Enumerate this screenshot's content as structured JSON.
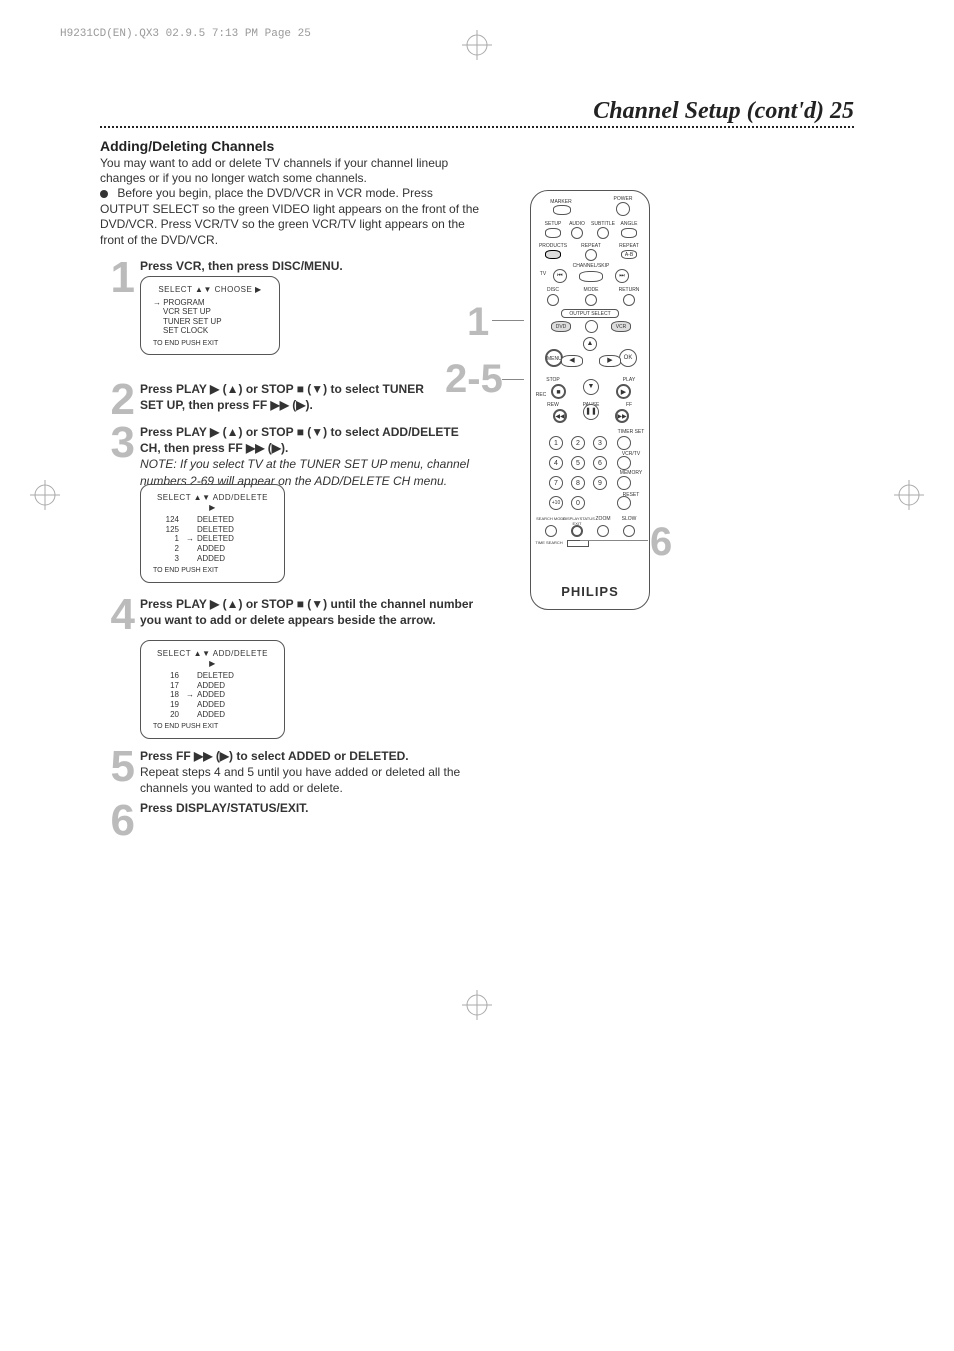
{
  "header_tag": "H9231CD(EN).QX3  02.9.5 7:13 PM  Page 25",
  "page_title": "Channel Setup (cont'd) 25",
  "section_heading": "Adding/Deleting Channels",
  "intro": "You may want to add or delete TV channels if your channel lineup changes or if you no longer watch some channels.",
  "bullet": "Before you begin, place the DVD/VCR in VCR mode. Press OUTPUT SELECT so the green VIDEO light appears on the front of the DVD/VCR. Press VCR/TV so the green VCR/TV light appears on the front of the DVD/VCR.",
  "steps": {
    "1": {
      "num": "1",
      "text_bold": "Press VCR, then press DISC/MENU.",
      "osd": {
        "head": "SELECT ▲▼ CHOOSE ▶",
        "lines": [
          "→ PROGRAM",
          "    VCR SET UP",
          "    TUNER SET UP",
          "    SET CLOCK"
        ],
        "foot": "TO END PUSH EXIT"
      }
    },
    "2": {
      "num": "2",
      "text": "Press PLAY ▶ (▲) or STOP ■ (▼) to select TUNER SET UP, then press FF ▶▶ (▶)."
    },
    "3": {
      "num": "3",
      "text": "Press PLAY ▶ (▲) or STOP ■ (▼) to select ADD/DELETE CH, then press FF ▶▶ (▶).",
      "note": "NOTE: If you select TV at the TUNER SET UP menu, channel numbers 2-69 will appear on the ADD/DELETE CH menu.",
      "osd": {
        "head": "SELECT ▲▼ ADD/DELETE ▶",
        "rows": [
          {
            "ch": "124",
            "arrow": "",
            "status": "DELETED"
          },
          {
            "ch": "125",
            "arrow": "",
            "status": "DELETED"
          },
          {
            "ch": "1",
            "arrow": "→",
            "status": "DELETED"
          },
          {
            "ch": "2",
            "arrow": "",
            "status": "ADDED"
          },
          {
            "ch": "3",
            "arrow": "",
            "status": "ADDED"
          }
        ],
        "foot": "TO END PUSH EXIT"
      }
    },
    "4": {
      "num": "4",
      "text": "Press PLAY ▶ (▲) or STOP ■ (▼) until the channel number you want to add or delete appears beside the arrow.",
      "osd": {
        "head": "SELECT ▲▼ ADD/DELETE ▶",
        "rows": [
          {
            "ch": "16",
            "arrow": "",
            "status": "DELETED"
          },
          {
            "ch": "17",
            "arrow": "",
            "status": "ADDED"
          },
          {
            "ch": "18",
            "arrow": "→",
            "status": "ADDED"
          },
          {
            "ch": "19",
            "arrow": "",
            "status": "ADDED"
          },
          {
            "ch": "20",
            "arrow": "",
            "status": "ADDED"
          }
        ],
        "foot": "TO END PUSH EXIT"
      }
    },
    "5": {
      "num": "5",
      "text_bold": "Press FF ▶▶ (▶) to select ADDED or DELETED.",
      "text_rest": "Repeat steps 4 and 5 until you have added or deleted all the channels you wanted to add or delete."
    },
    "6": {
      "num": "6",
      "text_bold": "Press DISPLAY/STATUS/EXIT."
    }
  },
  "remote": {
    "brand": "PHILIPS",
    "labels": {
      "marker": "MARKER",
      "power": "POWER",
      "setup": "SETUP",
      "audio": "AUDIO",
      "subtitle": "SUBTITLE",
      "angle": "ANGLE",
      "products": "PRODUCTS",
      "repeat1": "REPEAT",
      "repeat2": "REPEAT",
      "ab": "A-B",
      "channelskip": "CHANNEL/SKIP",
      "tv": "TV",
      "disc": "DISC",
      "mode": "MODE",
      "return": "RETURN",
      "outputselect": "OUTPUT SELECT",
      "dvd": "DVD",
      "vcr": "VCR",
      "menu": "MENU",
      "ok": "OK",
      "stop": "STOP",
      "play": "PLAY",
      "rew": "REW",
      "ff": "FF",
      "pause": "PAUSE",
      "rec": "REC",
      "timerset": "TIMER SET",
      "vcrtv": "VCR/TV",
      "memory": "MEMORY",
      "reset": "RESET",
      "searchmode": "SEARCH MODE",
      "display": "DISPLAYSTATUS EXIT",
      "zoom": "ZOOM",
      "slow": "SLOW",
      "timesearch": "TIME SEARCH"
    },
    "callouts": {
      "c1": "1",
      "c25": "2-5",
      "c6": "6"
    }
  }
}
